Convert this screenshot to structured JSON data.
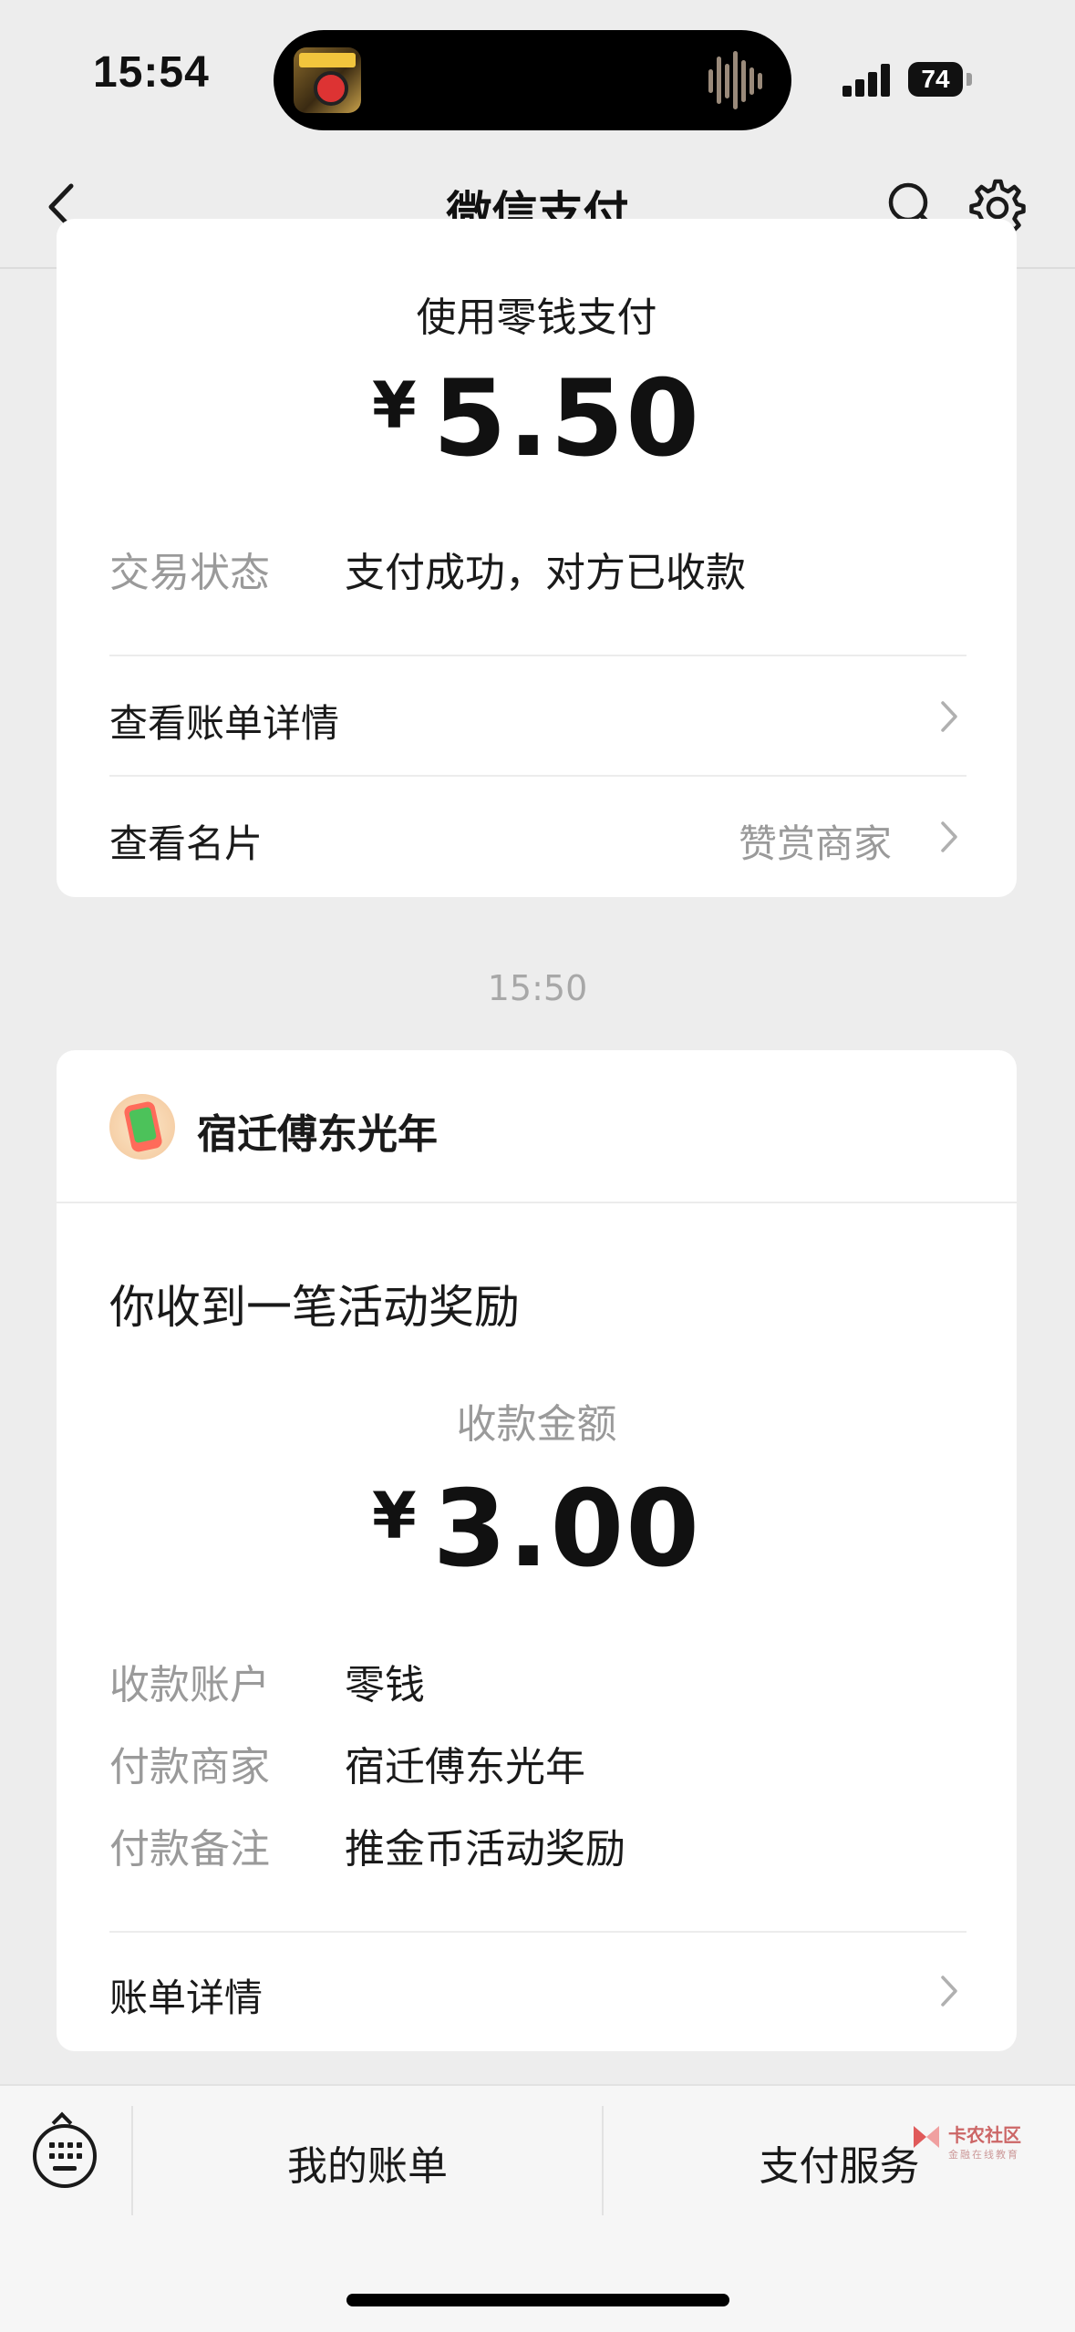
{
  "status_bar": {
    "time": "15:54",
    "battery": "74"
  },
  "nav": {
    "title": "微信支付"
  },
  "payment": {
    "method": "使用零钱支付",
    "currency": "¥",
    "amount": "5.50",
    "status_label": "交易状态",
    "status_value": "支付成功，对方已收款",
    "view_bill": "查看账单详情",
    "view_card": "查看名片",
    "card_value": "赞赏商家"
  },
  "timestamp": "15:50",
  "reward": {
    "merchant": "宿迁傅东光年",
    "title": "你收到一笔活动奖励",
    "amount_label": "收款金额",
    "currency": "¥",
    "amount": "3.00",
    "details": [
      {
        "label": "收款账户",
        "value": "零钱"
      },
      {
        "label": "付款商家",
        "value": "宿迁傅东光年"
      },
      {
        "label": "付款备注",
        "value": "推金币活动奖励"
      }
    ],
    "bill_details": "账单详情"
  },
  "bottom_bar": {
    "my_bills": "我的账单",
    "pay_services": "支付服务"
  },
  "watermark": {
    "text": "卡农社区",
    "sub": "金融在线教育"
  }
}
